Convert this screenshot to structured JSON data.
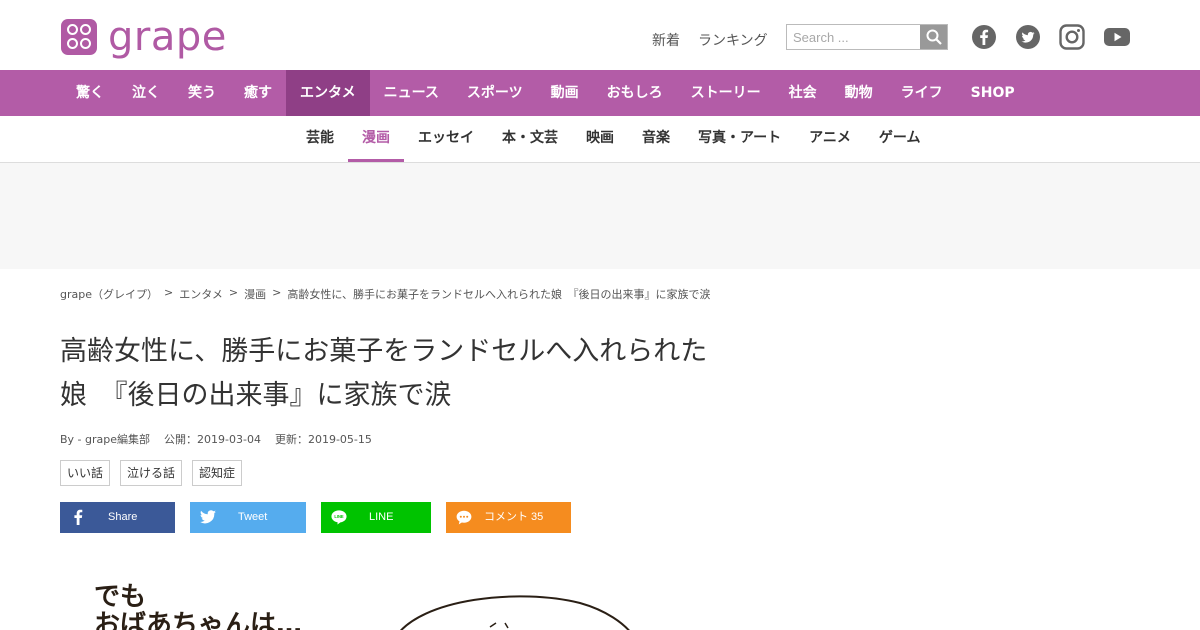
{
  "header": {
    "logo_text": "grape",
    "top_links": [
      "新着",
      "ランキング"
    ],
    "search_placeholder": "Search ...",
    "social_icons": [
      "facebook-icon",
      "twitter-icon",
      "instagram-icon",
      "youtube-icon"
    ]
  },
  "main_nav": {
    "items": [
      "驚く",
      "泣く",
      "笑う",
      "癒す",
      "エンタメ",
      "ニュース",
      "スポーツ",
      "動画",
      "おもしろ",
      "ストーリー",
      "社会",
      "動物",
      "ライフ",
      "SHOP"
    ],
    "active": "エンタメ"
  },
  "sub_nav": {
    "items": [
      "芸能",
      "漫画",
      "エッセイ",
      "本・文芸",
      "映画",
      "音楽",
      "写真・アート",
      "アニメ",
      "ゲーム"
    ],
    "active": "漫画"
  },
  "breadcrumb": [
    "grape（グレイプ）",
    "エンタメ",
    "漫画",
    "高齢女性に、勝手にお菓子をランドセルへ入れられた娘　『後日の出来事』に家族で涙"
  ],
  "breadcrumb_sep": ">",
  "article": {
    "title_line1": "高齢女性に、勝手にお菓子をランドセルへ入れられた",
    "title_line2": "娘　『後日の出来事』に家族で涙",
    "author": "By - grape編集部",
    "published": "公開：2019-03-04",
    "updated": "更新：2019-05-15",
    "tags": [
      "いい話",
      "泣ける話",
      "認知症"
    ]
  },
  "share": {
    "facebook": "Share",
    "twitter": "Tweet",
    "line": "LINE",
    "comment": "コメント 35"
  },
  "manga_text": [
    "でも",
    "おばあちゃんは…"
  ],
  "colors": {
    "brand": "#b35ca7",
    "brand_dark": "#8f3f86",
    "facebook": "#3b5998",
    "twitter": "#55acee",
    "line": "#00c300",
    "comment": "#f58c1f"
  }
}
